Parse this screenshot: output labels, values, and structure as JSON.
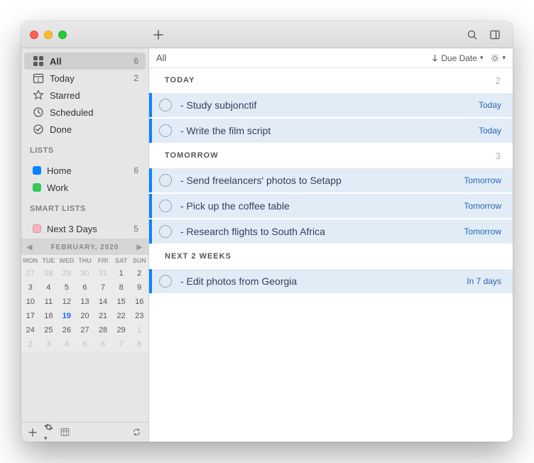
{
  "titlebar": {
    "add_icon": "plus",
    "search_icon": "search",
    "panel_icon": "panel"
  },
  "sidebar": {
    "builtin": [
      {
        "id": "all",
        "label": "All",
        "count": "6",
        "icon": "grid",
        "active": true
      },
      {
        "id": "today",
        "label": "Today",
        "count": "2",
        "icon": "cal"
      },
      {
        "id": "starred",
        "label": "Starred",
        "count": "",
        "icon": "star"
      },
      {
        "id": "scheduled",
        "label": "Scheduled",
        "count": "",
        "icon": "clock"
      },
      {
        "id": "done",
        "label": "Done",
        "count": "",
        "icon": "check"
      }
    ],
    "lists_header": "LISTS",
    "lists": [
      {
        "id": "home",
        "label": "Home",
        "count": "6",
        "color": "blue"
      },
      {
        "id": "work",
        "label": "Work",
        "count": "",
        "color": "green"
      }
    ],
    "smart_header": "SMART LISTS",
    "smart": [
      {
        "id": "next3",
        "label": "Next 3 Days",
        "count": "5",
        "color": "pink"
      }
    ]
  },
  "calendar": {
    "month": "FEBRUARY, 2020",
    "dow": [
      "MON",
      "TUE",
      "WED",
      "THU",
      "FRI",
      "SAT",
      "SUN"
    ],
    "rows": [
      [
        {
          "d": "27",
          "o": true
        },
        {
          "d": "28",
          "o": true
        },
        {
          "d": "29",
          "o": true
        },
        {
          "d": "30",
          "o": true
        },
        {
          "d": "31",
          "o": true
        },
        {
          "d": "1"
        },
        {
          "d": "2"
        }
      ],
      [
        {
          "d": "3"
        },
        {
          "d": "4"
        },
        {
          "d": "5"
        },
        {
          "d": "6"
        },
        {
          "d": "7"
        },
        {
          "d": "8"
        },
        {
          "d": "9"
        }
      ],
      [
        {
          "d": "10"
        },
        {
          "d": "11"
        },
        {
          "d": "12"
        },
        {
          "d": "13"
        },
        {
          "d": "14"
        },
        {
          "d": "15"
        },
        {
          "d": "16"
        }
      ],
      [
        {
          "d": "17"
        },
        {
          "d": "18"
        },
        {
          "d": "19",
          "t": true
        },
        {
          "d": "20"
        },
        {
          "d": "21"
        },
        {
          "d": "22"
        },
        {
          "d": "23"
        }
      ],
      [
        {
          "d": "24"
        },
        {
          "d": "25"
        },
        {
          "d": "26"
        },
        {
          "d": "27"
        },
        {
          "d": "28"
        },
        {
          "d": "29"
        },
        {
          "d": "1",
          "o": true
        }
      ],
      [
        {
          "d": "2",
          "o": true
        },
        {
          "d": "3",
          "o": true
        },
        {
          "d": "4",
          "o": true
        },
        {
          "d": "5",
          "o": true
        },
        {
          "d": "6",
          "o": true
        },
        {
          "d": "7",
          "o": true
        },
        {
          "d": "8",
          "o": true
        }
      ]
    ]
  },
  "filterbar": {
    "title": "All",
    "sort_label": "Due Date",
    "display_icon": "sun"
  },
  "sections": [
    {
      "title": "TODAY",
      "count": "2",
      "tasks": [
        {
          "title": "- Study subjonctif",
          "due": "Today"
        },
        {
          "title": "- Write the film script",
          "due": "Today"
        }
      ]
    },
    {
      "title": "TOMORROW",
      "count": "3",
      "tasks": [
        {
          "title": "- Send freelancers' photos to Setapp",
          "due": "Tomorrow"
        },
        {
          "title": "- Pick up the coffee table",
          "due": "Tomorrow"
        },
        {
          "title": "- Research flights to South Africa",
          "due": "Tomorrow"
        }
      ]
    },
    {
      "title": "NEXT 2 WEEKS",
      "count": "",
      "tasks": [
        {
          "title": "- Edit photos from Georgia",
          "due": "In 7 days"
        }
      ]
    }
  ]
}
